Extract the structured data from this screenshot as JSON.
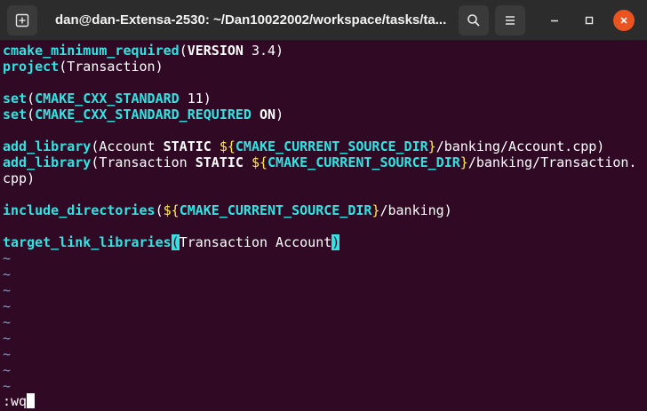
{
  "window": {
    "title": "dan@dan-Extensa-2530: ~/Dan10022002/workspace/tasks/ta...",
    "icons": {
      "new_tab": "new-tab-icon",
      "search": "search-icon",
      "menu": "hamburger-menu-icon",
      "minimize": "minimize-icon",
      "maximize": "maximize-icon",
      "close": "close-icon"
    },
    "colors": {
      "background": "#300a24",
      "keyword": "#34e2e2",
      "dollar": "#fce94f",
      "tilde": "#729fcf",
      "close_button": "#e95420"
    }
  },
  "editor": {
    "line1": {
      "kw": "cmake_minimum_required",
      "open": "(",
      "bold": "VERSION",
      "rest": " 3.4)"
    },
    "line2": {
      "kw": "project",
      "rest": "(Transaction)"
    },
    "line4": {
      "kw": "set",
      "open": "(",
      "var": "CMAKE_CXX_STANDARD",
      "rest": " 11)"
    },
    "line5": {
      "kw": "set",
      "open": "(",
      "var": "CMAKE_CXX_STANDARD_REQUIRED",
      "sp": " ",
      "bold": "ON",
      "close": ")"
    },
    "line7": {
      "kw": "add_library",
      "pre": "(Account ",
      "bold": "STATIC",
      "sp": " ",
      "dollar": "${",
      "var": "CMAKE_CURRENT_SOURCE_DIR",
      "dollar_close": "}",
      "rest": "/banking/Account.cpp)"
    },
    "line8": {
      "kw": "add_library",
      "pre": "(Transaction ",
      "bold": "STATIC",
      "sp": " ",
      "dollar": "${",
      "var": "CMAKE_CURRENT_SOURCE_DIR",
      "dollar_close": "}",
      "rest": "/banking/Transaction."
    },
    "line9": {
      "rest": "cpp)"
    },
    "line11": {
      "kw": "include_directories",
      "pre": "(",
      "dollar": "${",
      "var": "CMAKE_CURRENT_SOURCE_DIR",
      "dollar_close": "}",
      "rest": "/banking)"
    },
    "line13": {
      "kw": "target_link_libraries",
      "open_hl": "(",
      "mid": "Transaction Account",
      "close_hl": ")"
    },
    "tilde": "~",
    "command": ":wq"
  }
}
